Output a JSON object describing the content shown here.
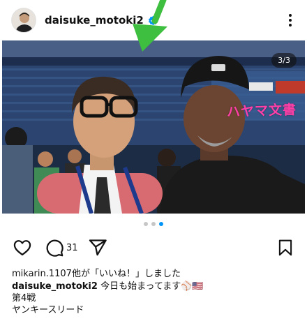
{
  "post": {
    "username": "daisuke_motoki2",
    "avatar": "avatar-photo",
    "verified": true,
    "more_icon": "more-icon"
  },
  "media": {
    "counter": "3/3",
    "watermark": "ハヤマ文書",
    "photo_description_icon": "photo",
    "pointer_color": "#3fbf3f",
    "carousel_total": 3,
    "carousel_active": 3
  },
  "actions": {
    "like_icon": "heart-icon",
    "comment_icon": "comment-icon",
    "comment_count": "31",
    "share_icon": "send-icon",
    "save_icon": "bookmark-icon"
  },
  "likes_text": "mikarin.1107他が「いいね！」しました",
  "caption": {
    "username": "daisuke_motoki2",
    "line1": "今日も始まってます⚾🇺🇸",
    "line2": "第4戦",
    "line3": "ヤンキースリード"
  },
  "colors": {
    "accent": "#0095f6",
    "text": "#111111",
    "watermark": "#ff3fa8"
  }
}
